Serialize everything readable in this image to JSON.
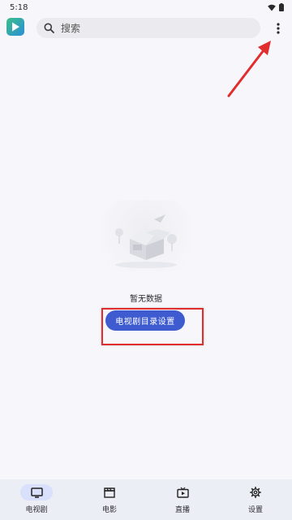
{
  "status_bar": {
    "time": "5:18"
  },
  "header": {
    "app_icon": "play-logo-icon",
    "search": {
      "placeholder": "搜索",
      "icon": "search-icon"
    },
    "more_icon": "more-vert-icon"
  },
  "empty_state": {
    "illustration": "empty-box-illustration",
    "message": "暂无数据",
    "action_label": "电视剧目录设置"
  },
  "bottom_nav": {
    "items": [
      {
        "label": "电视剧",
        "icon": "tv-icon",
        "active": true
      },
      {
        "label": "电影",
        "icon": "clapperboard-icon",
        "active": false
      },
      {
        "label": "直播",
        "icon": "live-tv-icon",
        "active": false
      },
      {
        "label": "设置",
        "icon": "gear-icon",
        "active": false
      }
    ]
  },
  "colors": {
    "accent": "#3f5bd0",
    "annotation": "#e12d2d",
    "background": "#f6f6fb",
    "nav_background": "#eceef6"
  }
}
